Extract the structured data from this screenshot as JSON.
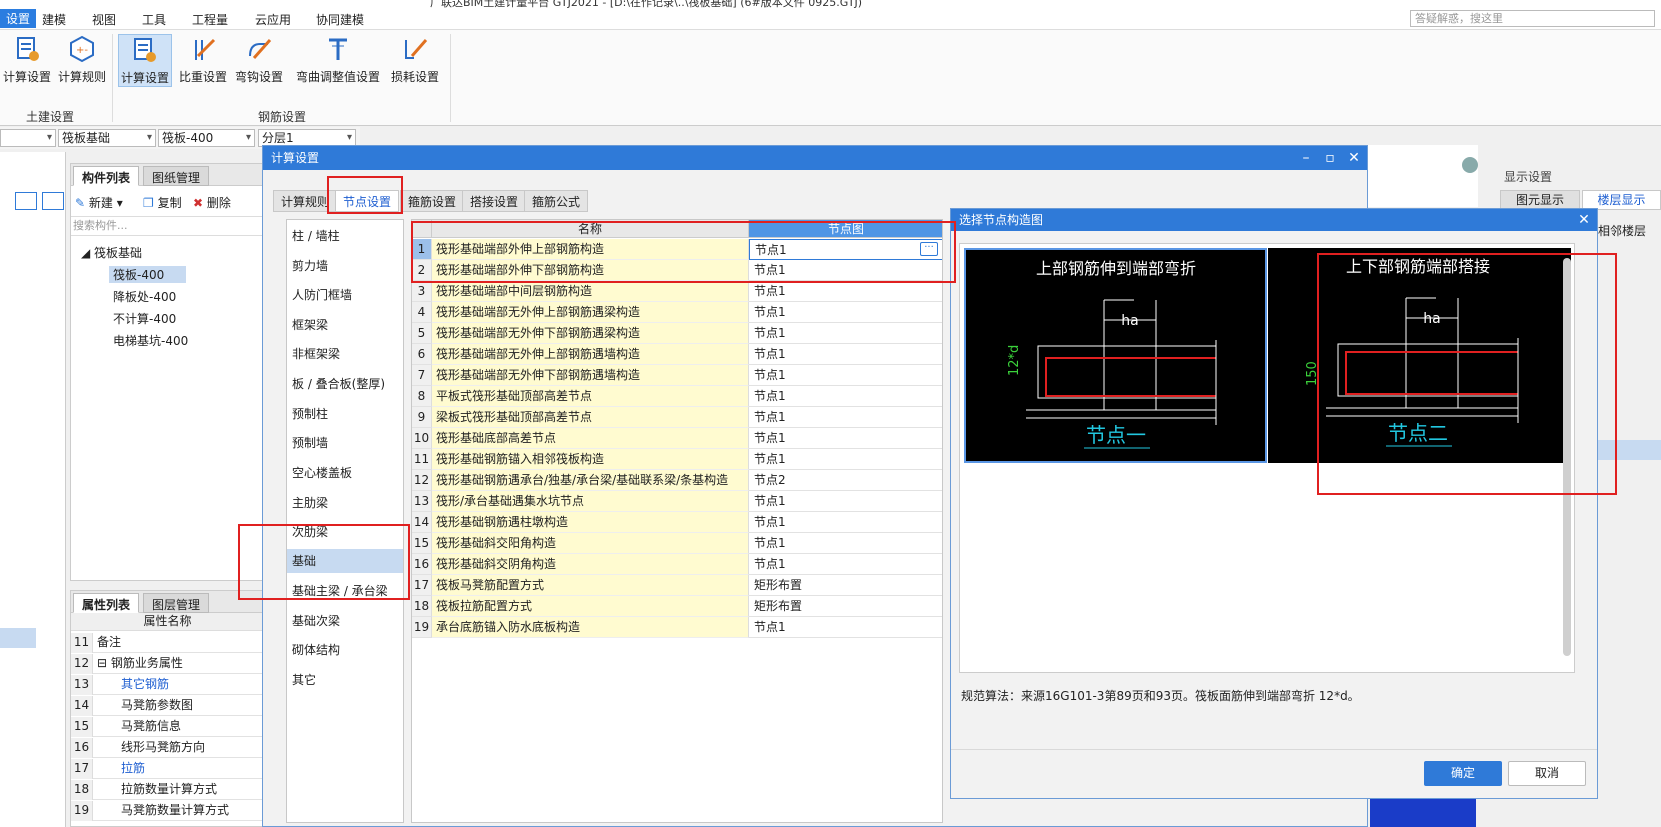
{
  "app": {
    "title_fragment": "广联达BIM土建计量平台 GTJ2021 - [D:\\在作记录\\..\\筏板基础] (6#版本文件 0925.GTJ)"
  },
  "menu": [
    "设置",
    "建模",
    "视图",
    "工具",
    "工程量",
    "云应用",
    "协同建模"
  ],
  "search_top": {
    "placeholder": "答疑解惑，搜这里"
  },
  "ribbon": {
    "group1": {
      "label": "土建设置",
      "buttons": [
        "计算设置",
        "计算规则"
      ]
    },
    "group2": {
      "label": "钢筋设置",
      "buttons": [
        "计算设置",
        "比重设置",
        "弯钩设置",
        "弯曲调整值设置",
        "损耗设置"
      ]
    }
  },
  "toolbar2": {
    "combo1": "筏板基础",
    "combo2": "筏板-400",
    "combo3": "分层1"
  },
  "component_panel": {
    "tabs": [
      "构件列表",
      "图纸管理"
    ],
    "actions": {
      "new": "新建",
      "copy": "复制",
      "delete": "删除"
    },
    "search_placeholder": "搜索构件...",
    "tree_root": "筏板基础",
    "tree_items": [
      "筏板-400",
      "降板处-400",
      "不计算-400",
      "电梯基坑-400"
    ]
  },
  "property_panel": {
    "tabs": [
      "属性列表",
      "图层管理"
    ],
    "header": "属性名称",
    "rows": [
      {
        "n": "11",
        "t": "备注"
      },
      {
        "n": "12",
        "t": "⊟ 钢筋业务属性"
      },
      {
        "n": "13",
        "t": "其它钢筋"
      },
      {
        "n": "14",
        "t": "马凳筋参数图"
      },
      {
        "n": "15",
        "t": "马凳筋信息"
      },
      {
        "n": "16",
        "t": "线形马凳筋方向"
      },
      {
        "n": "17",
        "t": "拉筋"
      },
      {
        "n": "18",
        "t": "拉筋数量计算方式"
      },
      {
        "n": "19",
        "t": "马凳筋数量计算方式"
      }
    ]
  },
  "calc_dialog": {
    "title": "计算设置",
    "tabs": [
      "计算规则",
      "节点设置",
      "箍筋设置",
      "搭接设置",
      "箍筋公式"
    ],
    "categories": [
      "柱 / 墙柱",
      "剪力墙",
      "人防门框墙",
      "框架梁",
      "非框架梁",
      "板 / 叠合板(整厚)",
      "预制柱",
      "预制墙",
      "空心楼盖板",
      "主肋梁",
      "次肋梁",
      "基础",
      "基础主梁 / 承台梁",
      "基础次梁",
      "砌体结构",
      "其它"
    ],
    "col_name": "名称",
    "col_node": "节点图",
    "rows": [
      {
        "n": "1",
        "name": "筏形基础端部外伸上部钢筋构造",
        "node": "节点1"
      },
      {
        "n": "2",
        "name": "筏形基础端部外伸下部钢筋构造",
        "node": "节点1"
      },
      {
        "n": "3",
        "name": "筏形基础端部中间层钢筋构造",
        "node": "节点1"
      },
      {
        "n": "4",
        "name": "筏形基础端部无外伸上部钢筋遇梁构造",
        "node": "节点1"
      },
      {
        "n": "5",
        "name": "筏形基础端部无外伸下部钢筋遇梁构造",
        "node": "节点1"
      },
      {
        "n": "6",
        "name": "筏形基础端部无外伸上部钢筋遇墙构造",
        "node": "节点1"
      },
      {
        "n": "7",
        "name": "筏形基础端部无外伸下部钢筋遇墙构造",
        "node": "节点1"
      },
      {
        "n": "8",
        "name": "平板式筏形基础顶部高差节点",
        "node": "节点1"
      },
      {
        "n": "9",
        "name": "梁板式筏形基础顶部高差节点",
        "node": "节点1"
      },
      {
        "n": "10",
        "name": "筏形基础底部高差节点",
        "node": "节点1"
      },
      {
        "n": "11",
        "name": "筏形基础钢筋锚入相邻筏板构造",
        "node": "节点1"
      },
      {
        "n": "12",
        "name": "筏形基础钢筋遇承台/独基/承台梁/基础联系梁/条基构造",
        "node": "节点2"
      },
      {
        "n": "13",
        "name": "筏形/承台基础遇集水坑节点",
        "node": "节点1"
      },
      {
        "n": "14",
        "name": "筏形基础钢筋遇柱墩构造",
        "node": "节点1"
      },
      {
        "n": "15",
        "name": "筏形基础斜交阳角构造",
        "node": "节点1"
      },
      {
        "n": "16",
        "name": "筏形基础斜交阴角构造",
        "node": "节点1"
      },
      {
        "n": "17",
        "name": "筏板马凳筋配置方式",
        "node": "矩形布置"
      },
      {
        "n": "18",
        "name": "筏板拉筋配置方式",
        "node": "矩形布置"
      },
      {
        "n": "19",
        "name": "承台底筋锚入防水底板构造",
        "node": "节点1"
      }
    ]
  },
  "node_dialog": {
    "title": "选择节点构造图",
    "card1": {
      "caption": "上部钢筋伸到端部弯折",
      "label": "节点一",
      "dim": "12*d",
      "ha": "ha"
    },
    "card2": {
      "caption": "上下部钢筋端部搭接",
      "label": "节点二",
      "dim": "150",
      "ha": "ha"
    },
    "spec": "规范算法：来源16G101-3第89页和93页。筏板面筋伸到端部弯折 12*d。",
    "ok": "确定",
    "cancel": "取消"
  },
  "right_panel": {
    "title": "显示设置",
    "tabs": [
      "图元显示",
      "楼层显示"
    ],
    "item": "相邻楼层"
  }
}
